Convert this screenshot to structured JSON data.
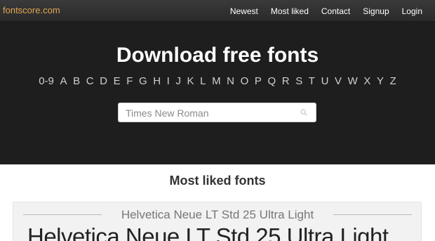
{
  "header": {
    "logo": "fontscore.com",
    "nav": [
      "Newest",
      "Most liked",
      "Contact",
      "Signup",
      "Login"
    ]
  },
  "hero": {
    "title": "Download free fonts",
    "alphabet": [
      "0-9",
      "A",
      "B",
      "C",
      "D",
      "E",
      "F",
      "G",
      "H",
      "I",
      "J",
      "K",
      "L",
      "M",
      "N",
      "O",
      "P",
      "Q",
      "R",
      "S",
      "T",
      "U",
      "V",
      "W",
      "X",
      "Y",
      "Z"
    ],
    "search": {
      "placeholder": "Times New Roman"
    }
  },
  "main": {
    "section_title": "Most liked fonts",
    "fonts": [
      {
        "name": "Helvetica Neue LT Std 25 Ultra Light",
        "preview": "Helvetica Neue LT Std 25 Ultra Light"
      }
    ]
  },
  "colors": {
    "logo": "#e0a550",
    "hero_bg": "#1e1e1e",
    "topbar_bg": "#2f2f2f"
  },
  "icons": {
    "search": "search-icon"
  }
}
